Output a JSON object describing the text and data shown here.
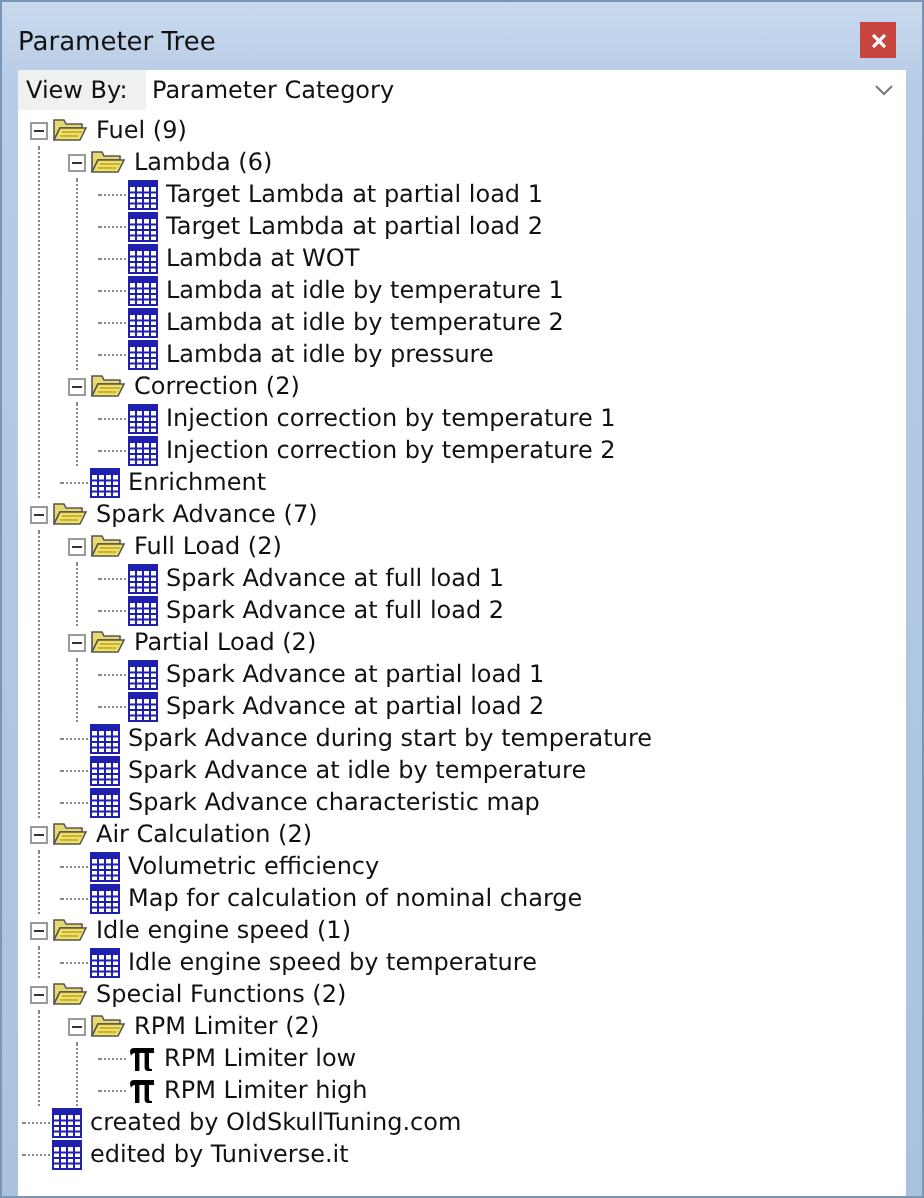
{
  "window": {
    "title": "Parameter Tree"
  },
  "view_by": {
    "label": "View By:",
    "value": "Parameter Category"
  },
  "tree": [
    {
      "kind": "folder",
      "label": "Fuel (9)",
      "expanded": true,
      "children": [
        {
          "kind": "folder",
          "label": "Lambda (6)",
          "expanded": true,
          "children": [
            {
              "kind": "table",
              "label": "Target Lambda at partial load 1"
            },
            {
              "kind": "table",
              "label": "Target Lambda at partial load 2"
            },
            {
              "kind": "table",
              "label": "Lambda at WOT"
            },
            {
              "kind": "table",
              "label": "Lambda at idle by temperature 1"
            },
            {
              "kind": "table",
              "label": "Lambda at idle by temperature 2"
            },
            {
              "kind": "table",
              "label": "Lambda at idle by pressure"
            }
          ]
        },
        {
          "kind": "folder",
          "label": "Correction (2)",
          "expanded": true,
          "children": [
            {
              "kind": "table",
              "label": "Injection correction by temperature 1"
            },
            {
              "kind": "table",
              "label": "Injection correction by temperature 2"
            }
          ]
        },
        {
          "kind": "table",
          "label": "Enrichment"
        }
      ]
    },
    {
      "kind": "folder",
      "label": "Spark Advance (7)",
      "expanded": true,
      "children": [
        {
          "kind": "folder",
          "label": "Full Load (2)",
          "expanded": true,
          "children": [
            {
              "kind": "table",
              "label": "Spark Advance at full load 1"
            },
            {
              "kind": "table",
              "label": "Spark Advance at full load 2"
            }
          ]
        },
        {
          "kind": "folder",
          "label": "Partial Load (2)",
          "expanded": true,
          "children": [
            {
              "kind": "table",
              "label": "Spark Advance at partial load 1"
            },
            {
              "kind": "table",
              "label": "Spark Advance at partial load 2"
            }
          ]
        },
        {
          "kind": "table",
          "label": "Spark Advance during start by temperature"
        },
        {
          "kind": "table",
          "label": "Spark Advance at idle by temperature"
        },
        {
          "kind": "table",
          "label": "Spark Advance characteristic map"
        }
      ]
    },
    {
      "kind": "folder",
      "label": "Air Calculation (2)",
      "expanded": true,
      "children": [
        {
          "kind": "table",
          "label": "Volumetric efficiency"
        },
        {
          "kind": "table",
          "label": "Map for calculation of nominal charge"
        }
      ]
    },
    {
      "kind": "folder",
      "label": "Idle engine speed (1)",
      "expanded": true,
      "children": [
        {
          "kind": "table",
          "label": "Idle engine speed by temperature"
        }
      ]
    },
    {
      "kind": "folder",
      "label": "Special Functions (2)",
      "expanded": true,
      "children": [
        {
          "kind": "folder",
          "label": "RPM Limiter (2)",
          "expanded": true,
          "children": [
            {
              "kind": "constant",
              "label": "RPM Limiter low"
            },
            {
              "kind": "constant",
              "label": "RPM Limiter high"
            }
          ]
        }
      ]
    },
    {
      "kind": "table",
      "label": "created by OldSkullTuning.com"
    },
    {
      "kind": "table",
      "label": "edited by Tuniverse.it"
    }
  ]
}
